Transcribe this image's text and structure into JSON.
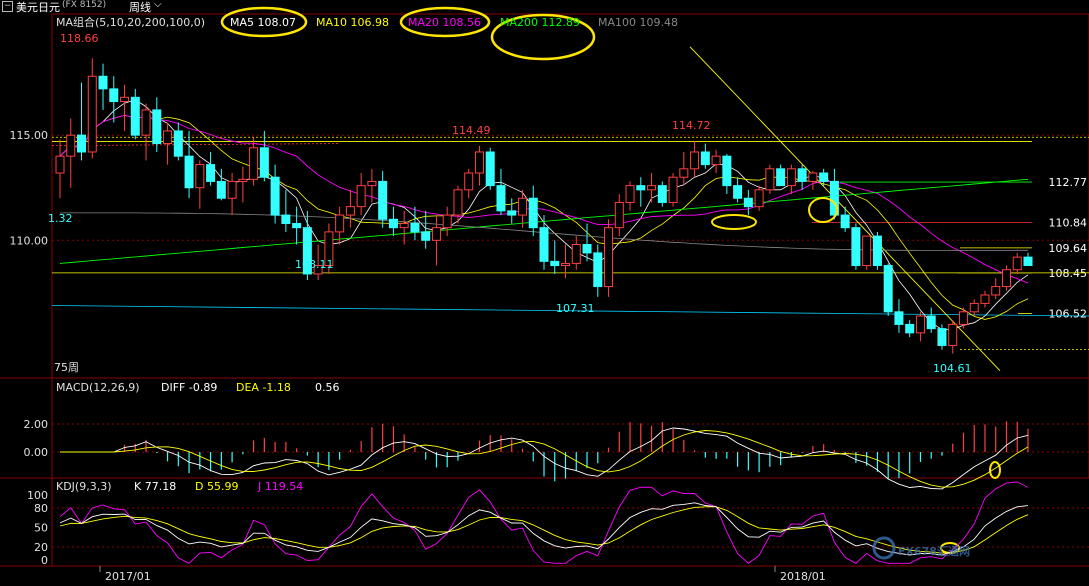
{
  "header": {
    "symbol": "美元日元",
    "code": "(FX 8152)",
    "period": "周线",
    "period_icon": "chevron-down-icon"
  },
  "ma_legend": {
    "group": "MA组合(5,10,20,200,100,0)",
    "items": [
      {
        "label": "MA5 108.07",
        "color": "#ffffff"
      },
      {
        "label": "MA10 106.98",
        "color": "#ffff00"
      },
      {
        "label": "MA20 108.56",
        "color": "#ff00ff"
      },
      {
        "label": "MA200 112.89",
        "color": "#00ff00"
      },
      {
        "label": "MA100 109.48",
        "color": "#888888"
      }
    ]
  },
  "macd_legend": {
    "title": "MACD(12,26,9)",
    "diff": "DIFF -0.89",
    "dea": "DEA -1.18",
    "macd": "0.56"
  },
  "kdj_legend": {
    "title": "KDJ(9,3,3)",
    "k": "K 77.18",
    "d": "D 55.99",
    "j": "J 119.54"
  },
  "price_axis": [
    "115.00",
    "110.00"
  ],
  "macd_axis": [
    "2.00",
    "0.00"
  ],
  "kdj_axis": [
    "100",
    "80",
    "50",
    "20",
    "0"
  ],
  "time_axis": [
    "2017/01",
    "2018/01"
  ],
  "price_annotations": [
    "118.66",
    "114.49",
    "114.72",
    "108.11",
    "107.31",
    "104.61",
    "75周",
    "1.32"
  ],
  "level_labels": [
    "112.77",
    "110.84",
    "109.64",
    "108.45",
    "106.52"
  ],
  "watermark": "FX678汇通网",
  "colors": {
    "up": "#ff4040",
    "down": "#33ffff",
    "ma5": "#ffffff",
    "ma10": "#ffff00",
    "ma20": "#ff00ff",
    "ma200": "#00ff00",
    "ma100": "#888888",
    "grid": "#8a0000",
    "highlight": "#ffe600"
  },
  "chart_data": {
    "type": "candlestick",
    "title": "",
    "period": "weekly",
    "ylim": [
      103.5,
      120
    ],
    "candles": [
      [
        113.2,
        114.8,
        112.0,
        114.0
      ],
      [
        114.0,
        115.8,
        112.5,
        115.0
      ],
      [
        115.0,
        117.5,
        113.8,
        114.2
      ],
      [
        114.2,
        118.66,
        113.9,
        117.8
      ],
      [
        117.8,
        118.4,
        116.2,
        117.2
      ],
      [
        117.2,
        117.8,
        115.6,
        116.6
      ],
      [
        116.6,
        117.4,
        115.2,
        116.8
      ],
      [
        116.8,
        117.2,
        114.8,
        115.0
      ],
      [
        115.0,
        116.5,
        113.8,
        116.2
      ],
      [
        116.2,
        116.8,
        114.2,
        114.6
      ],
      [
        114.6,
        115.6,
        113.6,
        115.2
      ],
      [
        115.2,
        115.6,
        113.8,
        114.0
      ],
      [
        114.0,
        115.2,
        112.0,
        112.5
      ],
      [
        112.5,
        113.8,
        111.5,
        113.6
      ],
      [
        113.6,
        114.2,
        112.6,
        112.8
      ],
      [
        112.8,
        113.4,
        111.9,
        112.0
      ],
      [
        112.0,
        113.2,
        111.2,
        112.8
      ],
      [
        112.8,
        113.5,
        111.8,
        112.9
      ],
      [
        112.9,
        114.9,
        112.6,
        114.4
      ],
      [
        114.4,
        115.2,
        112.8,
        113.0
      ],
      [
        113.0,
        113.6,
        110.8,
        111.2
      ],
      [
        111.2,
        112.4,
        110.4,
        110.8
      ],
      [
        110.8,
        111.6,
        109.8,
        110.6
      ],
      [
        110.6,
        111.4,
        108.11,
        108.4
      ],
      [
        108.4,
        109.8,
        108.11,
        108.8
      ],
      [
        108.8,
        110.8,
        108.4,
        110.4
      ],
      [
        110.4,
        111.6,
        109.8,
        111.2
      ],
      [
        111.2,
        112.4,
        110.6,
        111.6
      ],
      [
        111.6,
        113.2,
        111.2,
        112.6
      ],
      [
        112.6,
        113.4,
        111.8,
        112.8
      ],
      [
        112.8,
        113.3,
        110.6,
        111.0
      ],
      [
        111.0,
        111.6,
        110.2,
        110.6
      ],
      [
        110.6,
        111.4,
        109.8,
        110.8
      ],
      [
        110.8,
        111.6,
        110.0,
        110.4
      ],
      [
        110.4,
        111.4,
        109.6,
        110.0
      ],
      [
        110.0,
        111.2,
        108.8,
        110.6
      ],
      [
        110.6,
        111.6,
        110.2,
        111.2
      ],
      [
        111.2,
        112.6,
        110.8,
        112.4
      ],
      [
        112.4,
        113.4,
        112.0,
        113.2
      ],
      [
        113.2,
        114.49,
        112.6,
        114.2
      ],
      [
        114.2,
        114.4,
        112.4,
        112.6
      ],
      [
        112.6,
        113.4,
        111.2,
        111.4
      ],
      [
        111.4,
        112.0,
        110.8,
        111.2
      ],
      [
        111.2,
        112.4,
        110.6,
        112.0
      ],
      [
        112.0,
        112.6,
        110.2,
        110.6
      ],
      [
        110.6,
        111.2,
        108.6,
        109.0
      ],
      [
        109.0,
        110.0,
        108.4,
        108.8
      ],
      [
        108.8,
        109.8,
        108.2,
        108.9
      ],
      [
        108.9,
        110.2,
        108.6,
        109.8
      ],
      [
        109.8,
        110.8,
        109.0,
        109.4
      ],
      [
        109.4,
        109.8,
        107.31,
        107.8
      ],
      [
        107.8,
        111.0,
        107.31,
        110.6
      ],
      [
        110.6,
        112.2,
        110.2,
        111.8
      ],
      [
        111.8,
        112.8,
        111.4,
        112.6
      ],
      [
        112.6,
        113.0,
        111.6,
        112.4
      ],
      [
        112.4,
        113.2,
        111.8,
        112.6
      ],
      [
        112.6,
        112.8,
        111.6,
        111.8
      ],
      [
        111.8,
        113.2,
        111.6,
        113.0
      ],
      [
        113.0,
        114.2,
        112.6,
        113.4
      ],
      [
        113.4,
        114.72,
        113.0,
        114.2
      ],
      [
        114.2,
        114.6,
        113.4,
        113.6
      ],
      [
        113.6,
        114.3,
        113.2,
        114.0
      ],
      [
        114.0,
        114.1,
        112.2,
        112.6
      ],
      [
        112.6,
        113.0,
        111.8,
        112.0
      ],
      [
        112.0,
        112.4,
        111.2,
        111.6
      ],
      [
        111.6,
        112.6,
        111.4,
        112.4
      ],
      [
        112.4,
        113.6,
        112.2,
        113.4
      ],
      [
        113.4,
        113.6,
        112.6,
        112.6
      ],
      [
        112.6,
        113.6,
        112.2,
        113.4
      ],
      [
        113.4,
        113.6,
        112.4,
        112.8
      ],
      [
        112.8,
        113.3,
        112.4,
        113.2
      ],
      [
        113.2,
        113.4,
        112.6,
        112.8
      ],
      [
        112.8,
        113.4,
        111.0,
        111.2
      ],
      [
        111.2,
        111.6,
        110.4,
        110.6
      ],
      [
        110.6,
        110.8,
        108.6,
        108.8
      ],
      [
        108.8,
        110.2,
        108.6,
        110.2
      ],
      [
        110.2,
        110.4,
        108.6,
        108.8
      ],
      [
        108.8,
        108.9,
        106.4,
        106.6
      ],
      [
        106.6,
        107.2,
        105.6,
        106.0
      ],
      [
        106.0,
        106.2,
        105.4,
        105.6
      ],
      [
        105.6,
        106.6,
        105.2,
        106.4
      ],
      [
        106.4,
        106.8,
        105.6,
        105.8
      ],
      [
        105.8,
        106.0,
        104.8,
        105.0
      ],
      [
        105.0,
        106.2,
        104.61,
        106.0
      ],
      [
        106.0,
        106.8,
        105.8,
        106.6
      ],
      [
        106.6,
        107.2,
        106.4,
        107.0
      ],
      [
        107.0,
        107.6,
        106.8,
        107.4
      ],
      [
        107.4,
        108.2,
        107.2,
        107.8
      ],
      [
        107.8,
        108.8,
        107.6,
        108.6
      ],
      [
        108.6,
        109.4,
        108.4,
        109.2
      ],
      [
        109.2,
        109.4,
        108.8,
        108.8
      ]
    ]
  }
}
